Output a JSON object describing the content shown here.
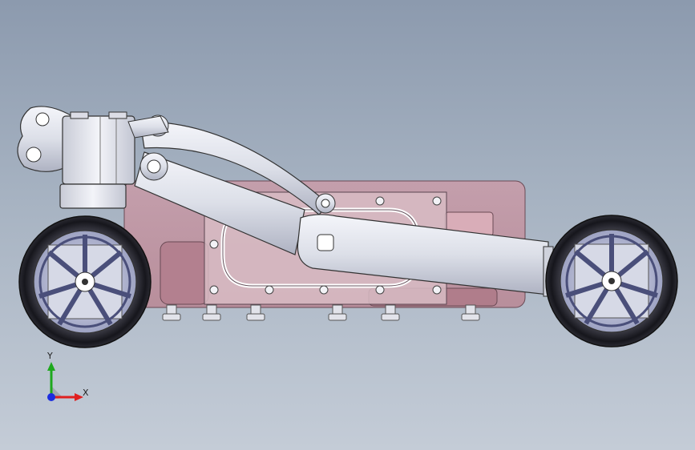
{
  "view": {
    "background_top": "#8c9aae",
    "background_bottom": "#c4ccd7"
  },
  "triad": {
    "y_label": "Y",
    "x_label": "X",
    "y_color": "#1ea81e",
    "x_color": "#e02020",
    "z_color": "#1c2de0"
  },
  "model": {
    "parts": [
      "pink-chassis-housing",
      "rear-wheel",
      "front-wheel",
      "upper-arm",
      "telescopic-leg",
      "sensor-mount",
      "bolt-row"
    ],
    "chassis_color": "#c79aa6",
    "metal_color": "#e4e6ee"
  }
}
